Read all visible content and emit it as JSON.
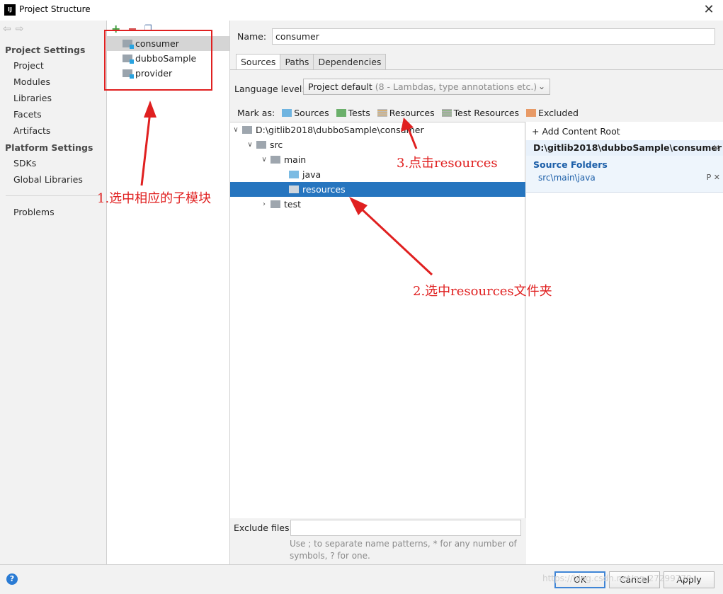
{
  "window": {
    "title": "Project Structure",
    "logo": "IJ",
    "close_icon": "✕"
  },
  "sidebar": {
    "project_settings_heading": "Project Settings",
    "project_items": [
      "Project",
      "Modules",
      "Libraries",
      "Facets",
      "Artifacts"
    ],
    "platform_settings_heading": "Platform Settings",
    "platform_items": [
      "SDKs",
      "Global Libraries"
    ],
    "problems": "Problems"
  },
  "modules": {
    "items": [
      {
        "label": "consumer",
        "selected": true
      },
      {
        "label": "dubboSample",
        "selected": false
      },
      {
        "label": "provider",
        "selected": false
      }
    ]
  },
  "content": {
    "name_label": "Name:",
    "name_value": "consumer",
    "tabs": [
      {
        "label": "Sources",
        "active": true
      },
      {
        "label": "Paths",
        "active": false
      },
      {
        "label": "Dependencies",
        "active": false
      }
    ],
    "language_level_label": "Language level:",
    "language_level_value": "Project default",
    "language_level_hint": "(8 - Lambdas, type annotations etc.)",
    "mark_as_label": "Mark as:",
    "mark_as_options": [
      "Sources",
      "Tests",
      "Resources",
      "Test Resources",
      "Excluded"
    ],
    "tree": [
      {
        "label": "D:\\gitlib2018\\dubboSample\\consumer",
        "depth": 0,
        "expanded": true,
        "folder": "gray",
        "selected": false
      },
      {
        "label": "src",
        "depth": 1,
        "expanded": true,
        "folder": "gray",
        "selected": false
      },
      {
        "label": "main",
        "depth": 2,
        "expanded": true,
        "folder": "gray",
        "selected": false
      },
      {
        "label": "java",
        "depth": 3,
        "expanded": null,
        "folder": "blue",
        "selected": false
      },
      {
        "label": "resources",
        "depth": 3,
        "expanded": null,
        "folder": "gray",
        "selected": true
      },
      {
        "label": "test",
        "depth": 2,
        "expanded": false,
        "folder": "gray",
        "selected": false
      }
    ],
    "exclude_files_label": "Exclude files:",
    "exclude_files_value": "",
    "exclude_hint": "Use ; to separate name patterns, * for any number of symbols, ? for one."
  },
  "content_roots": {
    "add_label": "Add Content Root",
    "root_path": "D:\\gitlib2018\\dubboSample\\consumer",
    "source_folders_heading": "Source Folders",
    "source_folders": [
      "src\\main\\java"
    ]
  },
  "buttons": {
    "help": "?",
    "ok": "OK",
    "cancel": "Cancel",
    "apply": "Apply"
  },
  "annotations": {
    "step1": "1.选中相应的子模块",
    "step2": "2.选中resources文件夹",
    "step3": "3.点击resources",
    "color": "#e02020"
  },
  "watermark": "https://blog.csdn.net/qq_27299779",
  "colors": {
    "selection": "#2675bf",
    "source_folder_text": "#1b5ea8",
    "add_icon": "#3e9e3e",
    "remove_icon": "#d04040"
  }
}
